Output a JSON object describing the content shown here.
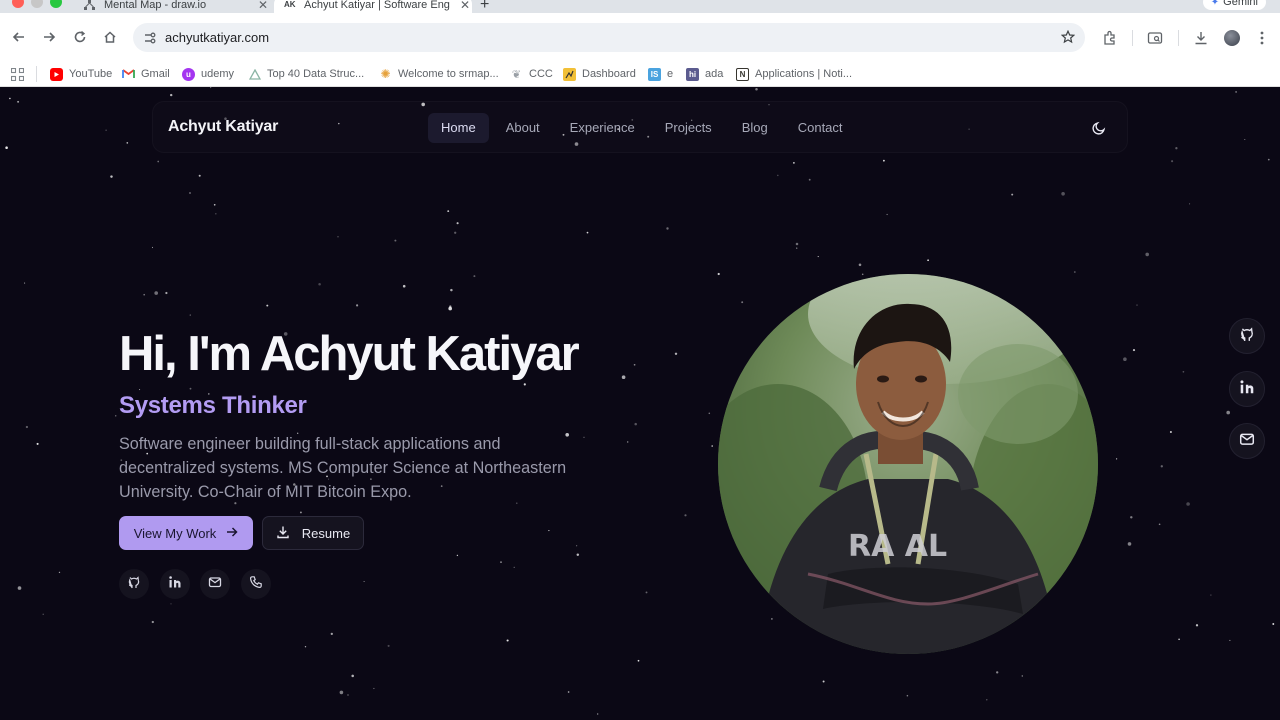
{
  "browser": {
    "tabs": [
      {
        "title": "Mental Map - draw.io",
        "favicon": "drawio-icon",
        "active": false
      },
      {
        "title": "Achyut Katiyar | Software Eng",
        "favicon": "AK",
        "active": true
      }
    ],
    "gemini_label": "Gemini",
    "url": "achyutkatiyar.com",
    "bookmarks": [
      {
        "label": "YouTube",
        "icon": "youtube-icon",
        "color": "#ff0000"
      },
      {
        "label": "Gmail",
        "icon": "gmail-icon",
        "color": "#ea4335"
      },
      {
        "label": "udemy",
        "icon": "udemy-icon",
        "color": "#a435f0"
      },
      {
        "label": "Top 40 Data Struc...",
        "icon": "triangle-icon",
        "color": "#8ab4a4"
      },
      {
        "label": "Welcome to srmap...",
        "icon": "sun-icon",
        "color": "#e6a23c"
      },
      {
        "label": "CCC",
        "icon": "leaf-icon",
        "color": "#9aa0a6"
      },
      {
        "label": "Dashboard",
        "icon": "dashboard-icon",
        "color": "#f2c037"
      },
      {
        "label": "e",
        "icon": "is-icon",
        "icon_text": "IS",
        "color": "#4aa3df"
      },
      {
        "label": "ada",
        "icon": "hi-icon",
        "icon_text": "hi",
        "color": "#5b5b8f"
      },
      {
        "label": "Applications | Noti...",
        "icon": "notion-icon",
        "icon_text": "N",
        "color": "#37352f"
      }
    ]
  },
  "site": {
    "brand": "Achyut Katiyar",
    "nav": [
      {
        "label": "Home",
        "active": true
      },
      {
        "label": "About",
        "active": false
      },
      {
        "label": "Experience",
        "active": false
      },
      {
        "label": "Projects",
        "active": false
      },
      {
        "label": "Blog",
        "active": false
      },
      {
        "label": "Contact",
        "active": false
      }
    ],
    "hero": {
      "title": "Hi, I'm Achyut Katiyar",
      "role": "Systems Thinker",
      "description": "Software engineer building full-stack applications and decentralized systems. MS Computer Science at Northeastern University. Co-Chair of MIT Bitcoin Expo.",
      "primary_button": "View My Work",
      "secondary_button": "Resume"
    },
    "colors": {
      "background": "#0b0815",
      "accent": "#b09af0",
      "role_text": "#b39cf3"
    },
    "social_icons": [
      "github-icon",
      "linkedin-icon",
      "mail-icon",
      "phone-icon"
    ],
    "side_icons": [
      "github-icon",
      "linkedin-icon",
      "mail-icon"
    ]
  }
}
